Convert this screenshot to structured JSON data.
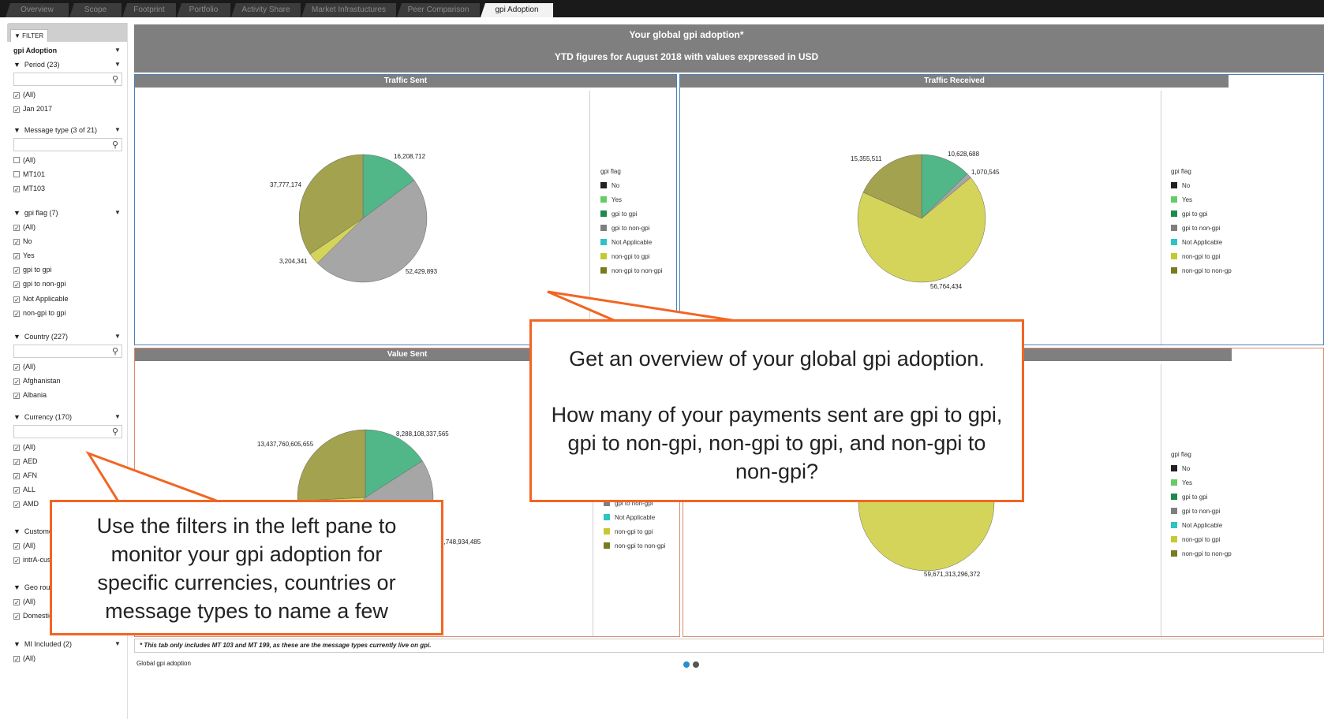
{
  "tabs": [
    "Overview",
    "Scope",
    "Footprint",
    "Portfolio",
    "Activity Share",
    "Market Infrastuctures",
    "Peer Comparison",
    "gpi Adoption"
  ],
  "active_tab": "gpi Adoption",
  "sidebar": {
    "filter_tab": "FILTER",
    "title": "gpi Adoption",
    "period_header": "Period (23)",
    "period_items": [
      "(All)",
      "Jan 2017"
    ],
    "message_header": "Message type (3 of 21)",
    "message_items": [
      "(All)",
      "MT101",
      "MT103"
    ],
    "gpi_header": "gpi flag (7)",
    "gpi_items": [
      "(All)",
      "No",
      "Yes",
      "gpi to gpi",
      "gpi to non-gpi",
      "Not Applicable",
      "non-gpi to gpi"
    ],
    "country_header": "Country (227)",
    "country_items": [
      "(All)",
      "Afghanistan",
      "Albania"
    ],
    "currency_header": "Currency (170)",
    "currency_items": [
      "(All)",
      "AED",
      "AFN",
      "ALL",
      "AMD"
    ],
    "customer_header": "Customer route (2)",
    "customer_items": [
      "(All)",
      "intrA-customer-group"
    ],
    "geo_header": "Geo route (2)",
    "geo_items": [
      "(All)",
      "Domestic"
    ],
    "mi_header": "MI Included (2)",
    "mi_items": [
      "(All)"
    ]
  },
  "header": {
    "title": "Your global gpi adoption*",
    "subtitle": "YTD figures for August 2018 with values expressed in USD"
  },
  "legend": {
    "title": "gpi flag",
    "items": [
      "No",
      "Yes",
      "gpi to gpi",
      "gpi to non-gpi",
      "Not Applicable",
      "non-gpi to gpi",
      "non-gpi to non-gpi"
    ],
    "items_clipped": [
      "No",
      "Yes",
      "gpi to gpi",
      "gpi to non-gpi",
      "Not Applicable",
      "non-gpi to gpi",
      "non-gpi to non-gp"
    ],
    "colors": [
      "#222222",
      "#66cc66",
      "#1e8a4c",
      "#7f7f7f",
      "#2ec4c4",
      "#c8c832",
      "#7a7a1e"
    ]
  },
  "chart_data": [
    {
      "type": "pie",
      "title": "Traffic Sent",
      "labels": [
        "gpi to gpi",
        "gpi to non-gpi",
        "non-gpi to gpi",
        "non-gpi to non-gpi"
      ],
      "values": [
        16208712,
        52429893,
        3204341,
        37777174
      ],
      "value_labels": [
        "16,208,712",
        "52,429,893",
        "3,204,341",
        "37,777,174"
      ],
      "colors": [
        "#52b788",
        "#a6a6a6",
        "#d4d45a",
        "#a3a24e"
      ]
    },
    {
      "type": "pie",
      "title": "Traffic Received",
      "labels": [
        "gpi to gpi",
        "gpi to non-gpi",
        "non-gpi to gpi",
        "non-gpi to non-gpi"
      ],
      "values": [
        10628688,
        1070545,
        56764434,
        15355511
      ],
      "value_labels": [
        "10,628,688",
        "1,070,545",
        "56,764,434",
        "15,355,511"
      ],
      "colors": [
        "#52b788",
        "#a6a6a6",
        "#d4d45a",
        "#a3a24e"
      ]
    },
    {
      "type": "pie",
      "title": "Value Sent",
      "labels": [
        "gpi to gpi",
        "gpi to non-gpi",
        "non-gpi to gpi",
        "non-gpi to non-gpi"
      ],
      "values": [
        8288108337565,
        23308748934485,
        7000000000000,
        13437760605655
      ],
      "value_labels": [
        "8,288,108,337,565",
        "23,308,748,934,485",
        "",
        "13,437,760,605,655"
      ],
      "colors": [
        "#52b788",
        "#a6a6a6",
        "#d4d45a",
        "#a3a24e"
      ]
    },
    {
      "type": "pie",
      "title": "",
      "labels": [
        "non-gpi to gpi"
      ],
      "values": [
        59671313296372
      ],
      "value_labels": [
        "59,671,313,296,372"
      ],
      "colors": [
        "#d4d45a"
      ]
    }
  ],
  "footnote": "* This tab only includes MT 103 and MT 199, as these are the message types currently live on gpi.",
  "footer_label": "Global gpi adoption",
  "callouts": {
    "right_line1": "Get an overview of your global gpi adoption.",
    "right_line2": "How many of your payments sent are gpi to gpi, gpi to non-gpi, non-gpi to gpi, and non-gpi to non-gpi?",
    "left": "Use the filters in the left pane to monitor your gpi adoption for specific currencies, countries or message types to name a few"
  },
  "colors": {
    "callout_border": "#f26522",
    "panel_header": "#7f7f7f",
    "dot_active": "#2a8bd1",
    "dot_inactive": "#555555"
  }
}
